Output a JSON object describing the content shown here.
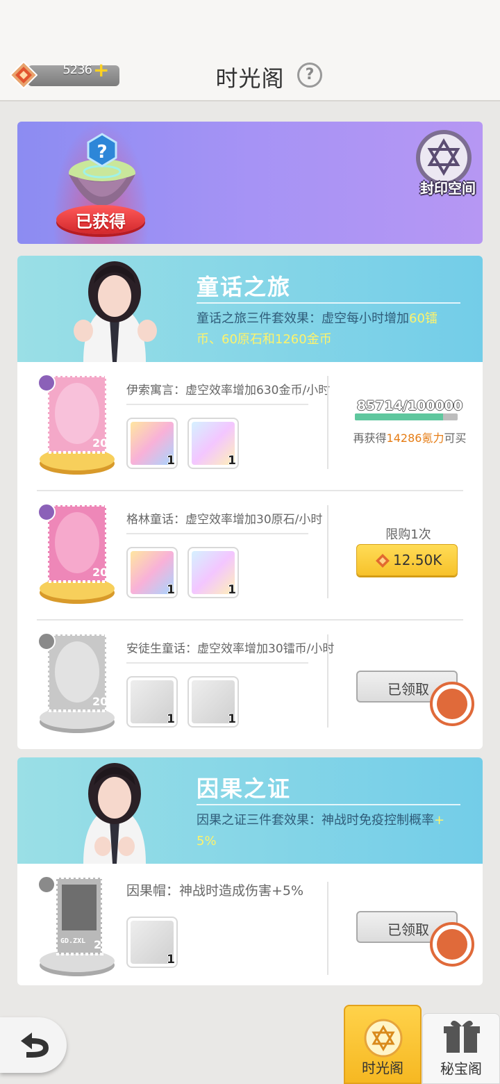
{
  "header": {
    "currency_amount": "5236",
    "currency_plus": "+",
    "title": "时光阁",
    "help_label": "?"
  },
  "banner": {
    "obtained_label": "已获得",
    "seal_label": "封印空间"
  },
  "sets": [
    {
      "title": "童话之旅",
      "effect_prefix": "童话之旅三件套效果：虚空每小时增加",
      "effect_hl1": "60镭",
      "effect_line2_hl": "币、60原石和1260金币",
      "items": [
        {
          "desc": "伊索寓言：虚空效率增加630金币/小时",
          "stamp_level": "20",
          "rewards": [
            "1",
            "1"
          ],
          "progress_text": "85714/100000",
          "progress_fraction": 0.857,
          "more_prefix": "再获得",
          "more_amount": "14286氪力",
          "more_suffix": "可买"
        },
        {
          "desc": "格林童话：虚空效率增加30原石/小时",
          "stamp_level": "20",
          "rewards": [
            "1",
            "1"
          ],
          "limit_text": "限购1次",
          "price": "12.50K"
        },
        {
          "desc": "安徒生童话：虚空效率增加30镭币/小时",
          "stamp_level": "20",
          "rewards": [
            "1",
            "1"
          ],
          "claimed_label": "已领取"
        }
      ]
    },
    {
      "title": "因果之证",
      "effect_prefix": "因果之证三件套效果：神战时免疫控制概率",
      "effect_hl1": "+",
      "effect_line2_hl": "5%",
      "items": [
        {
          "desc": "因果帽：神战时造成伤害+5%",
          "stamp_level": "20",
          "stamp_text": "GD.ZXL",
          "rewards": [
            "1"
          ],
          "claimed_label": "已领取"
        }
      ]
    }
  ],
  "nav": {
    "tab_active": "时光阁",
    "tab_other": "秘宝阁"
  },
  "colors": {
    "accent_yellow": "#f7c22b",
    "header_teal": "#73cde8",
    "banner_purple": "#a693f5",
    "highlight_yellow": "#fff36a",
    "orange": "#e57c14"
  }
}
